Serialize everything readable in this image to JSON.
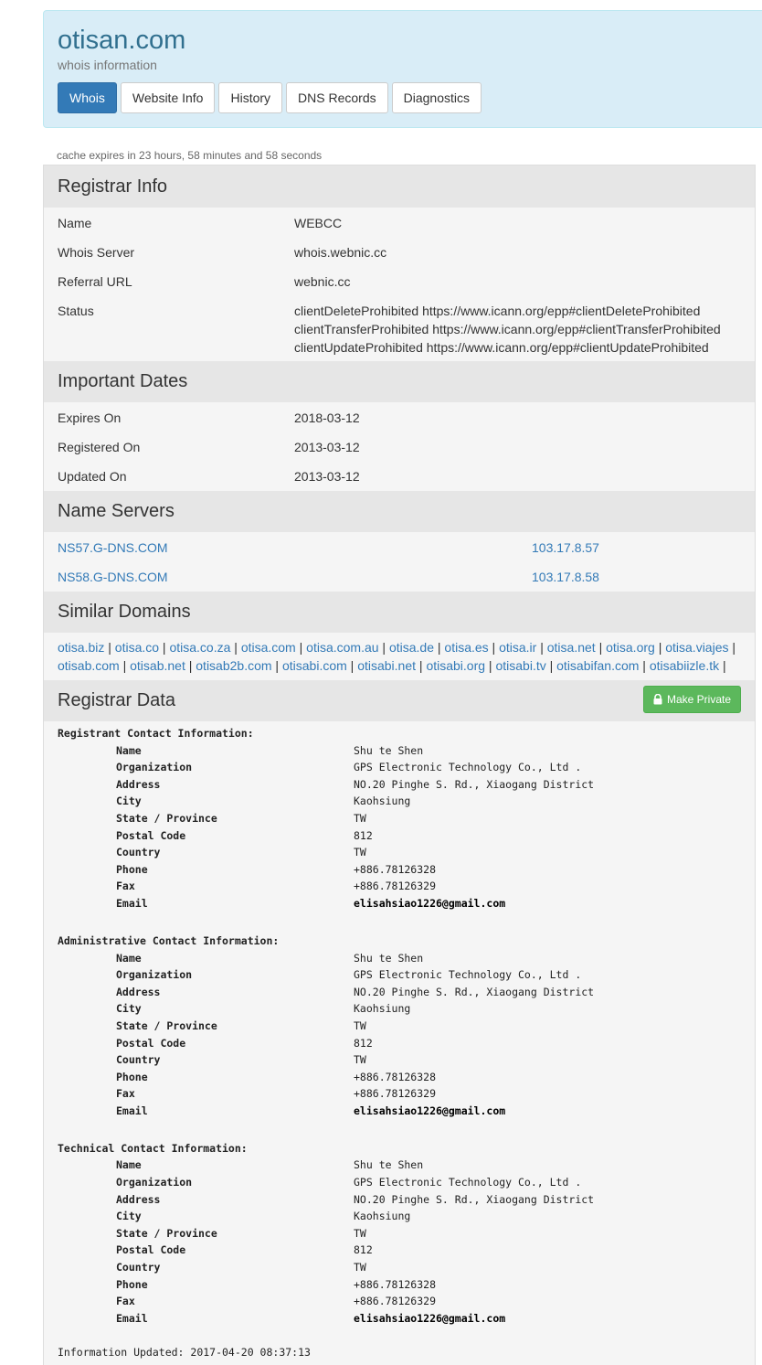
{
  "header": {
    "domain": "otisan.com",
    "subtitle": "whois information",
    "tabs": [
      "Whois",
      "Website Info",
      "History",
      "DNS Records",
      "Diagnostics"
    ],
    "active_tab": "Whois"
  },
  "cache_note": "cache expires in 23 hours, 58 minutes and 58 seconds",
  "registrar_info": {
    "title": "Registrar Info",
    "name_label": "Name",
    "name_value": "WEBCC",
    "whois_server_label": "Whois Server",
    "whois_server_value": "whois.webnic.cc",
    "referral_label": "Referral URL",
    "referral_value": "webnic.cc",
    "status_label": "Status",
    "status_values": [
      "clientDeleteProhibited https://www.icann.org/epp#clientDeleteProhibited",
      "clientTransferProhibited https://www.icann.org/epp#clientTransferProhibited",
      "clientUpdateProhibited https://www.icann.org/epp#clientUpdateProhibited"
    ]
  },
  "important_dates": {
    "title": "Important Dates",
    "expires_label": "Expires On",
    "expires_value": "2018-03-12",
    "registered_label": "Registered On",
    "registered_value": "2013-03-12",
    "updated_label": "Updated On",
    "updated_value": "2013-03-12"
  },
  "name_servers": {
    "title": "Name Servers",
    "items": [
      {
        "host": "NS57.G-DNS.COM",
        "ip": "103.17.8.57"
      },
      {
        "host": "NS58.G-DNS.COM",
        "ip": "103.17.8.58"
      }
    ]
  },
  "similar_domains": {
    "title": "Similar Domains",
    "items": [
      "otisa.biz",
      "otisa.co",
      "otisa.co.za",
      "otisa.com",
      "otisa.com.au",
      "otisa.de",
      "otisa.es",
      "otisa.ir",
      "otisa.net",
      "otisa.org",
      "otisa.viajes",
      "otisab.com",
      "otisab.net",
      "otisab2b.com",
      "otisabi.com",
      "otisabi.net",
      "otisabi.org",
      "otisabi.tv",
      "otisabifan.com",
      "otisabiizle.tk"
    ]
  },
  "registrar_data": {
    "title": "Registrar Data",
    "make_private_label": "Make Private",
    "blocks": [
      {
        "title": "Registrant Contact Information:",
        "fields": [
          {
            "label": "Name",
            "value": "Shu te Shen"
          },
          {
            "label": "Organization",
            "value": "GPS Electronic Technology Co., Ltd ."
          },
          {
            "label": "Address",
            "value": "NO.20 Pinghe S. Rd., Xiaogang District"
          },
          {
            "label": "City",
            "value": "Kaohsiung"
          },
          {
            "label": "State / Province",
            "value": "TW"
          },
          {
            "label": "Postal Code",
            "value": "812"
          },
          {
            "label": "Country",
            "value": "TW"
          },
          {
            "label": "Phone",
            "value": "+886.78126328"
          },
          {
            "label": "Fax",
            "value": "+886.78126329"
          },
          {
            "label": "Email",
            "value": "elisahsiao1226@gmail.com"
          }
        ]
      },
      {
        "title": "Administrative Contact Information:",
        "fields": [
          {
            "label": "Name",
            "value": "Shu te Shen"
          },
          {
            "label": "Organization",
            "value": "GPS Electronic Technology Co., Ltd ."
          },
          {
            "label": "Address",
            "value": "NO.20 Pinghe S. Rd., Xiaogang District"
          },
          {
            "label": "City",
            "value": "Kaohsiung"
          },
          {
            "label": "State / Province",
            "value": "TW"
          },
          {
            "label": "Postal Code",
            "value": "812"
          },
          {
            "label": "Country",
            "value": "TW"
          },
          {
            "label": "Phone",
            "value": "+886.78126328"
          },
          {
            "label": "Fax",
            "value": "+886.78126329"
          },
          {
            "label": "Email",
            "value": "elisahsiao1226@gmail.com"
          }
        ]
      },
      {
        "title": "Technical Contact Information:",
        "fields": [
          {
            "label": "Name",
            "value": "Shu te Shen"
          },
          {
            "label": "Organization",
            "value": "GPS Electronic Technology Co., Ltd ."
          },
          {
            "label": "Address",
            "value": "NO.20 Pinghe S. Rd., Xiaogang District"
          },
          {
            "label": "City",
            "value": "Kaohsiung"
          },
          {
            "label": "State / Province",
            "value": "TW"
          },
          {
            "label": "Postal Code",
            "value": "812"
          },
          {
            "label": "Country",
            "value": "TW"
          },
          {
            "label": "Phone",
            "value": "+886.78126328"
          },
          {
            "label": "Fax",
            "value": "+886.78126329"
          },
          {
            "label": "Email",
            "value": "elisahsiao1226@gmail.com"
          }
        ]
      }
    ],
    "footer": "Information Updated: 2017-04-20 08:37:13"
  }
}
